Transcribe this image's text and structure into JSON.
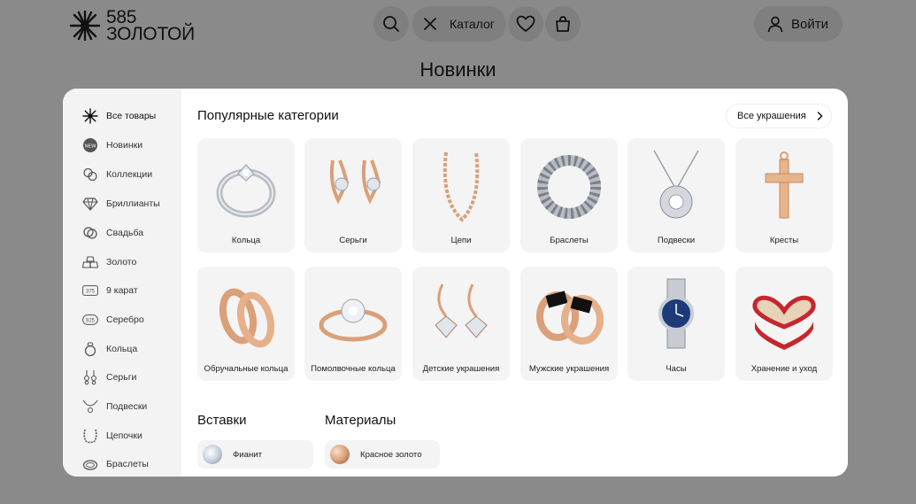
{
  "header": {
    "logo_number": "585",
    "logo_name": "ЗОЛОТОЙ",
    "catalog_label": "Каталог",
    "login_label": "Войти"
  },
  "page_title": "Новинки",
  "sidebar": {
    "items": [
      {
        "label": "Все товары",
        "icon": "sparkle-icon"
      },
      {
        "label": "Новинки",
        "icon": "new-badge-icon"
      },
      {
        "label": "Коллекции",
        "icon": "collections-icon"
      },
      {
        "label": "Бриллианты",
        "icon": "diamond-icon"
      },
      {
        "label": "Свадьба",
        "icon": "wedding-rings-icon"
      },
      {
        "label": "Золото",
        "icon": "gold-bars-icon"
      },
      {
        "label": "9 карат",
        "icon": "575-stamp-icon"
      },
      {
        "label": "Серебро",
        "icon": "925-stamp-icon"
      },
      {
        "label": "Кольца",
        "icon": "ring-icon"
      },
      {
        "label": "Серьги",
        "icon": "earrings-icon"
      },
      {
        "label": "Подвески",
        "icon": "pendant-icon"
      },
      {
        "label": "Цепочки",
        "icon": "chain-icon"
      },
      {
        "label": "Браслеты",
        "icon": "bracelet-icon"
      }
    ]
  },
  "popular": {
    "title": "Популярные категории",
    "all_label": "Все украшения",
    "categories": [
      "Кольца",
      "Серьги",
      "Цепи",
      "Браслеты",
      "Подвески",
      "Кресты",
      "Обручальные кольца",
      "Помолвочные кольца",
      "Детские украшения",
      "Мужские украшения",
      "Часы",
      "Хранение и уход"
    ]
  },
  "inserts": {
    "title": "Вставки",
    "items": [
      "Фианит"
    ]
  },
  "materials": {
    "title": "Материалы",
    "items": [
      "Красное золото"
    ]
  },
  "colors": {
    "background": "#8a8a8a",
    "panel": "#ffffff",
    "sidebar": "#f3f3f3",
    "card": "#f4f4f4",
    "gold": "#d9a07a",
    "silver": "#b8bcc4"
  }
}
